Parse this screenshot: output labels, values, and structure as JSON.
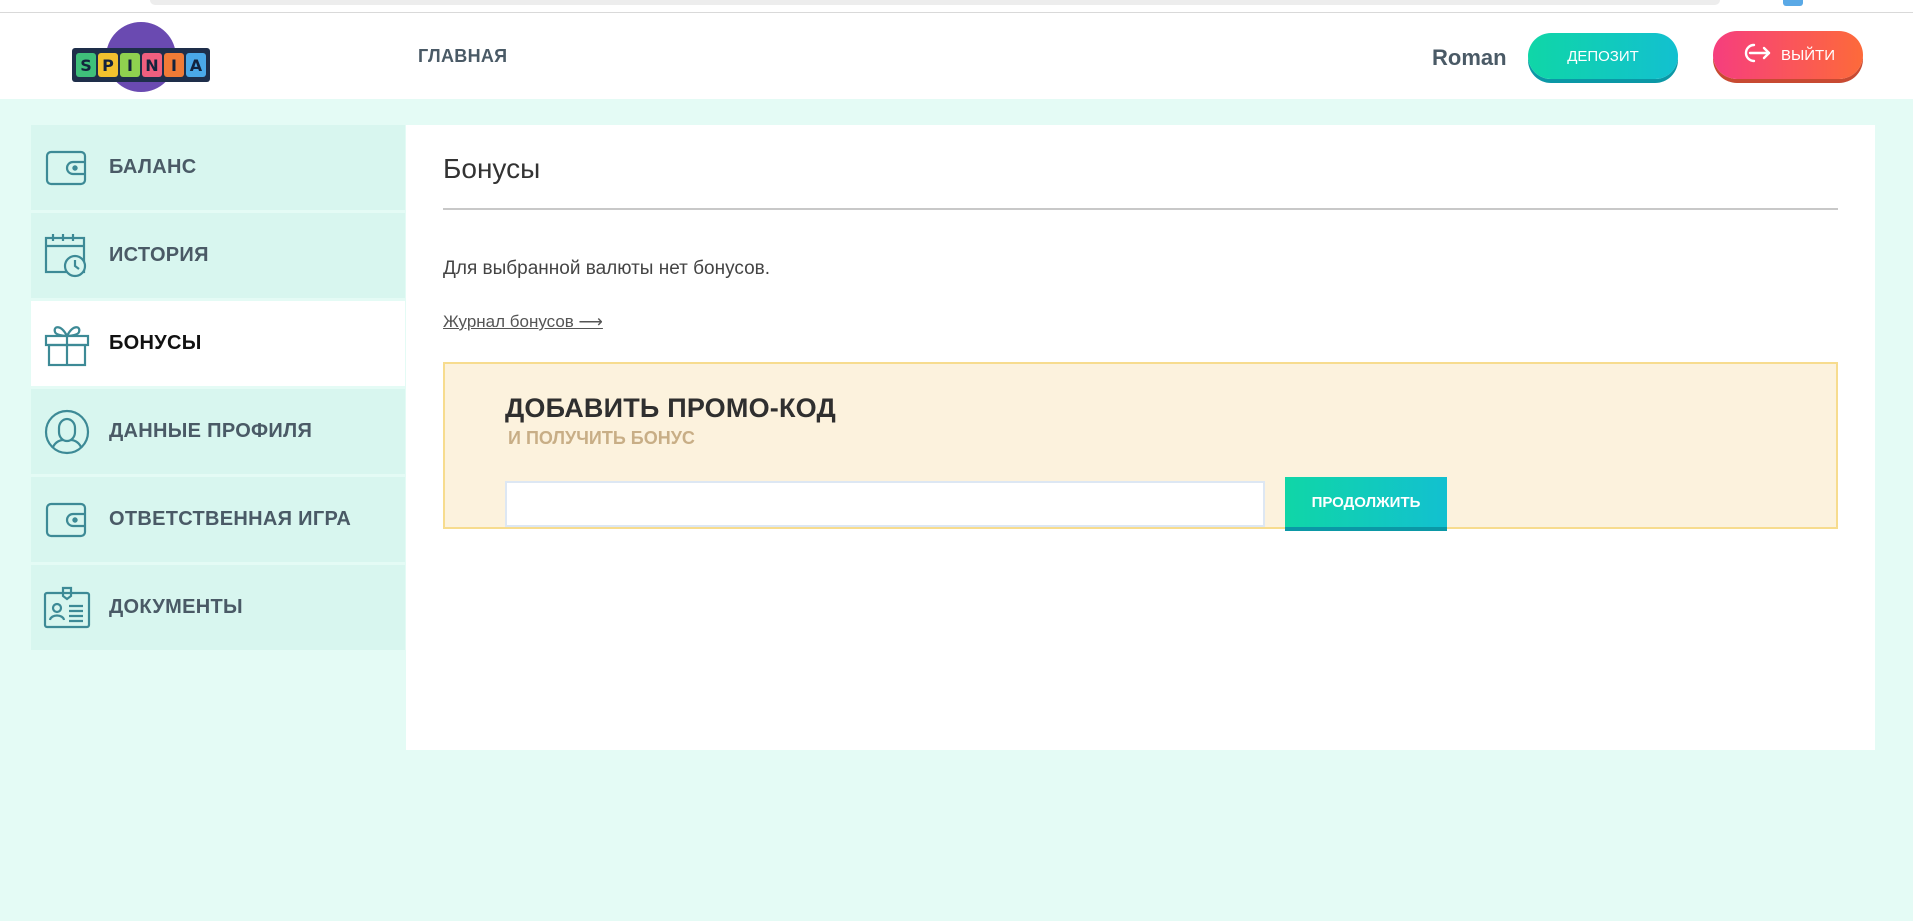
{
  "header": {
    "logo_letters": [
      "S",
      "P",
      "I",
      "N",
      "I",
      "A"
    ],
    "logo_colors": [
      "#3fbf7a",
      "#f2c12e",
      "#8fd14f",
      "#ef5f7f",
      "#f07b36",
      "#4aa8e8"
    ],
    "nav_home": "ГЛАВНАЯ",
    "username": "Roman",
    "deposit_label": "ДЕПОЗИТ",
    "logout_label": "ВЫЙТИ"
  },
  "sidebar": {
    "items": [
      {
        "label": "БАЛАНС",
        "icon": "wallet-icon"
      },
      {
        "label": "ИСТОРИЯ",
        "icon": "calendar-clock-icon"
      },
      {
        "label": "БОНУСЫ",
        "icon": "gift-icon",
        "active": true
      },
      {
        "label": "ДАННЫЕ ПРОФИЛЯ",
        "icon": "user-icon"
      },
      {
        "label": "ОТВЕТСТВЕННАЯ ИГРА",
        "icon": "wallet-icon"
      },
      {
        "label": "ДОКУМЕНТЫ",
        "icon": "id-card-icon"
      }
    ]
  },
  "main": {
    "title": "Бонусы",
    "empty_message": "Для выбранной валюты нет бонусов.",
    "journal_link": "Журнал бонусов ⟶",
    "promo": {
      "title": "ДОБАВИТЬ ПРОМО-КОД",
      "subtitle": "И ПОЛУЧИТЬ БОНУС",
      "input_value": "",
      "continue_label": "ПРОДОЛЖИТЬ"
    }
  },
  "colors": {
    "accent_teal": "#10d6a7",
    "accent_red": "#f63e7e",
    "page_bg": "#e4fbf5",
    "sidebar_bg": "#d8f6ef",
    "promo_bg": "#fcf2dd"
  }
}
